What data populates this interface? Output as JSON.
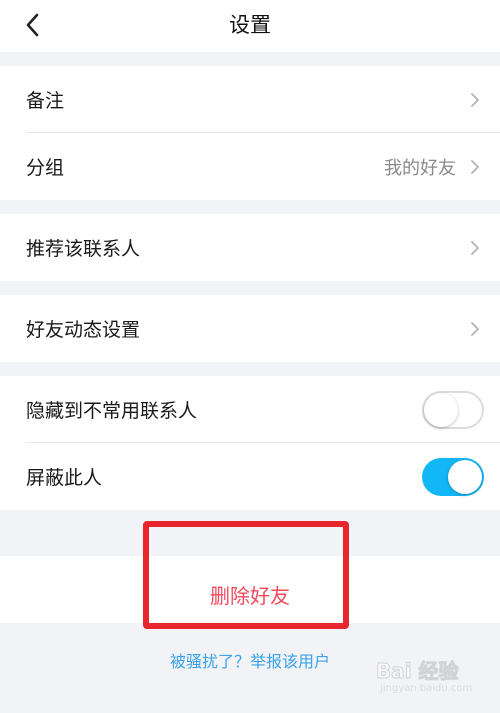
{
  "header": {
    "title": "设置",
    "back_icon": "chevron-left-icon"
  },
  "groups": [
    {
      "rows": [
        {
          "label": "备注",
          "value": ""
        },
        {
          "label": "分组",
          "value": "我的好友"
        }
      ]
    },
    {
      "rows": [
        {
          "label": "推荐该联系人"
        }
      ]
    },
    {
      "rows": [
        {
          "label": "好友动态设置"
        }
      ]
    },
    {
      "rows": [
        {
          "label": "隐藏到不常用联系人",
          "toggle": "off"
        },
        {
          "label": "屏蔽此人",
          "toggle": "on"
        }
      ]
    }
  ],
  "actions": {
    "delete_label": "删除好友",
    "report_link": "被骚扰了？举报该用户"
  },
  "watermark": {
    "brand": "Bai 经验",
    "sub": "jingyan.baidu.com"
  },
  "colors": {
    "toggle_on": "#12b7f5",
    "delete_text": "#f24a5b",
    "link": "#3aa2ea",
    "highlight": "#e8262e"
  }
}
